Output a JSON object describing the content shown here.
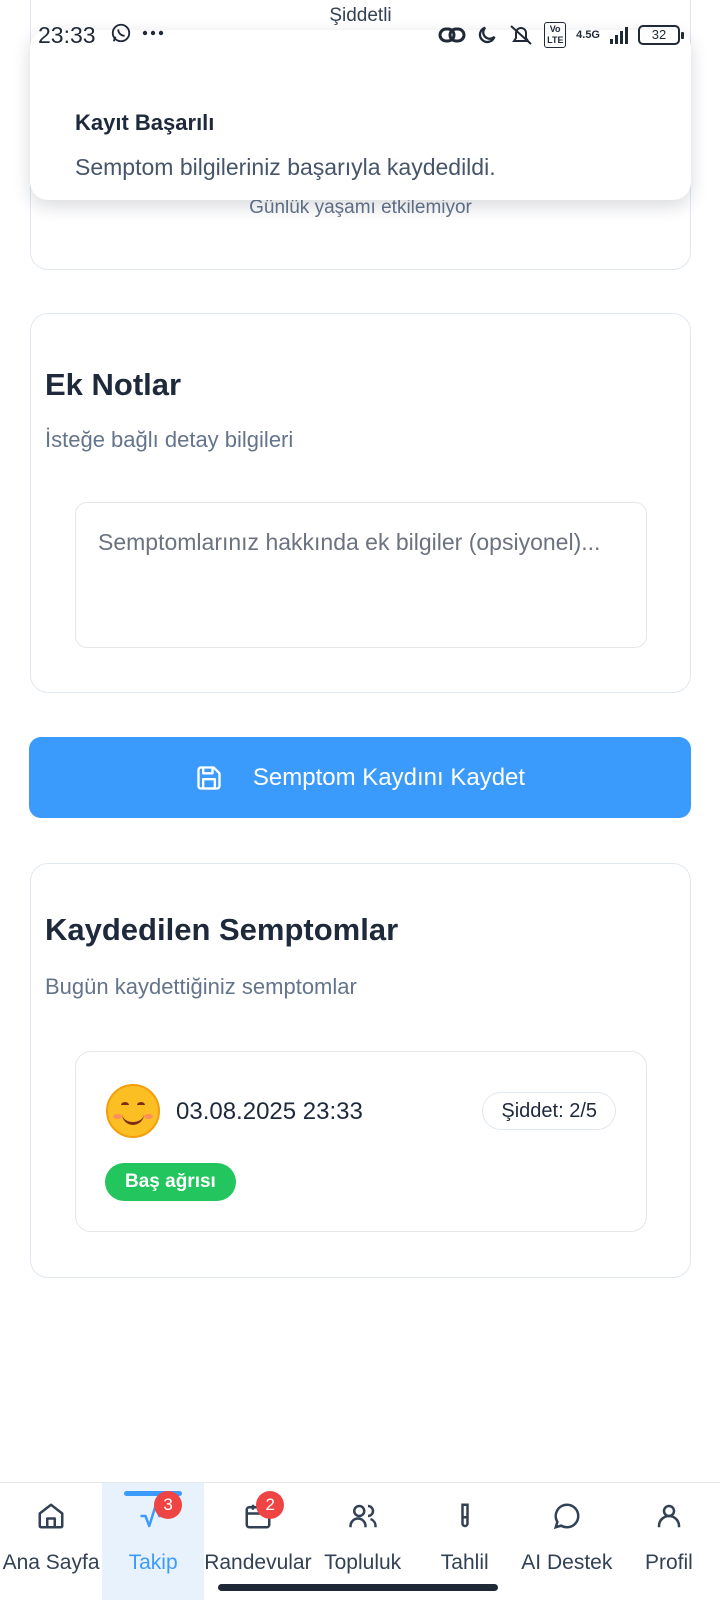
{
  "status_bar": {
    "time": "23:33",
    "battery": "32",
    "network": "4.5G",
    "volte": "Vo LTE",
    "icons": [
      "whatsapp-icon",
      "more-dots-icon",
      "link-icon",
      "moon-icon",
      "mute-icon",
      "volte-icon",
      "signal-icon",
      "battery-icon"
    ]
  },
  "severity_card": {
    "caption": "Şiddetli",
    "hint": "Günlük yaşamı etkilemiyor"
  },
  "toast": {
    "title": "Kayıt Başarılı",
    "description": "Semptom bilgileriniz başarıyla kaydedildi."
  },
  "notes_card": {
    "title": "Ek Notlar",
    "subtitle": "İsteğe bağlı detay bilgileri",
    "placeholder": "Semptomlarınız hakkında ek bilgiler (opsiyonel)...",
    "value": ""
  },
  "save_button": {
    "label": "Semptom Kaydını Kaydet",
    "icon": "save-icon",
    "color": "#3b9bfc"
  },
  "saved_card": {
    "title": "Kaydedilen Semptomlar",
    "subtitle": "Bugün kaydettiğiniz semptomlar",
    "entries": [
      {
        "emoji": "smiling-face-icon",
        "datetime": "03.08.2025 23:33",
        "severity": "Şiddet: 2/5",
        "tags": [
          "Baş ağrısı"
        ],
        "tag_color": "#22c55e"
      }
    ]
  },
  "bottom_nav": {
    "active_color": "#3b9bfc",
    "items": [
      {
        "label": "Ana Sayfa",
        "icon": "home-icon",
        "active": false,
        "badge": null
      },
      {
        "label": "Takip",
        "icon": "activity-icon",
        "active": true,
        "badge": "3"
      },
      {
        "label": "Randevular",
        "icon": "calendar-icon",
        "active": false,
        "badge": "2"
      },
      {
        "label": "Topluluk",
        "icon": "users-icon",
        "active": false,
        "badge": null
      },
      {
        "label": "Tahlil",
        "icon": "test-tube-icon",
        "active": false,
        "badge": null
      },
      {
        "label": "AI Destek",
        "icon": "chat-bubble-icon",
        "active": false,
        "badge": null
      },
      {
        "label": "Profil",
        "icon": "user-icon",
        "active": false,
        "badge": null
      }
    ]
  }
}
